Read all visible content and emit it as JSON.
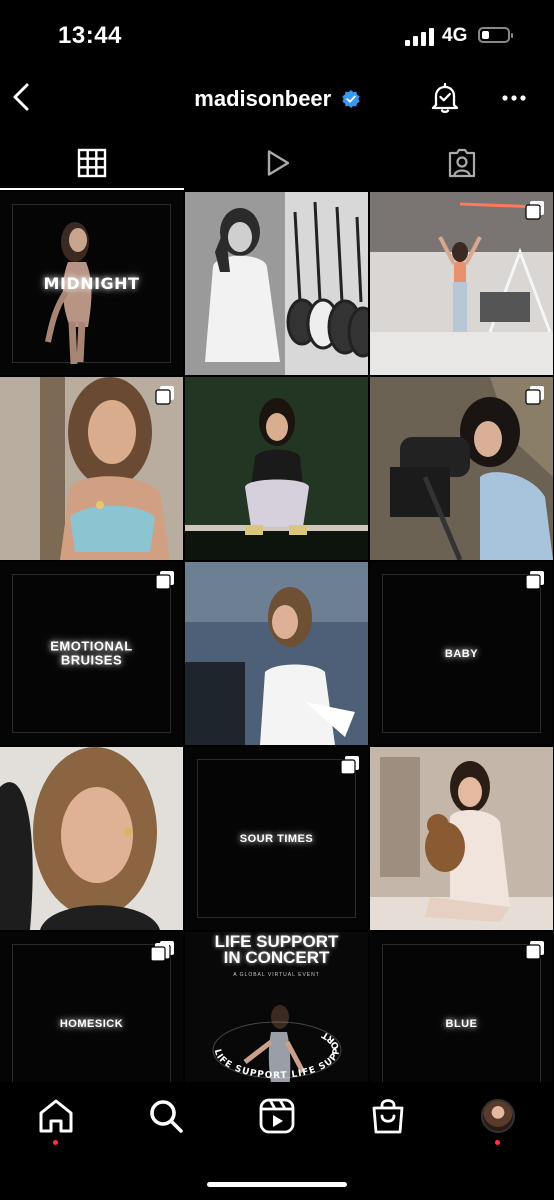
{
  "status_bar": {
    "time": "13:44",
    "network": "4G"
  },
  "header": {
    "username": "madisonbeer"
  },
  "tabs": [
    {
      "icon": "grid-icon",
      "active": true
    },
    {
      "icon": "reels-play-icon",
      "active": false
    },
    {
      "icon": "tagged-person-icon",
      "active": false
    }
  ],
  "posts": {
    "midnight": "MIDNIGHT",
    "emotional_bruises_1": "EMOTIONAL",
    "emotional_bruises_2": "BRUISES",
    "baby": "BABY",
    "sour_times": "SOUR TIMES",
    "homesick": "HOMESICK",
    "blue": "BLUE",
    "concert_title_1": "LIFE SUPPORT",
    "concert_title_2": "IN CONCERT",
    "concert_subtitle": "A GLOBAL VIRTUAL EVENT",
    "concert_ring": "LIFE SUPPORT LIFE SUPPORT"
  },
  "bottom_nav": [
    {
      "icon": "home-icon",
      "notification_dot": true
    },
    {
      "icon": "search-icon",
      "notification_dot": false
    },
    {
      "icon": "reels-icon",
      "notification_dot": false
    },
    {
      "icon": "shop-icon",
      "notification_dot": false
    },
    {
      "icon": "profile-avatar",
      "notification_dot": true
    }
  ],
  "colors": {
    "background": "#000000",
    "verified": "#3897f0",
    "notification": "#ff3040"
  }
}
